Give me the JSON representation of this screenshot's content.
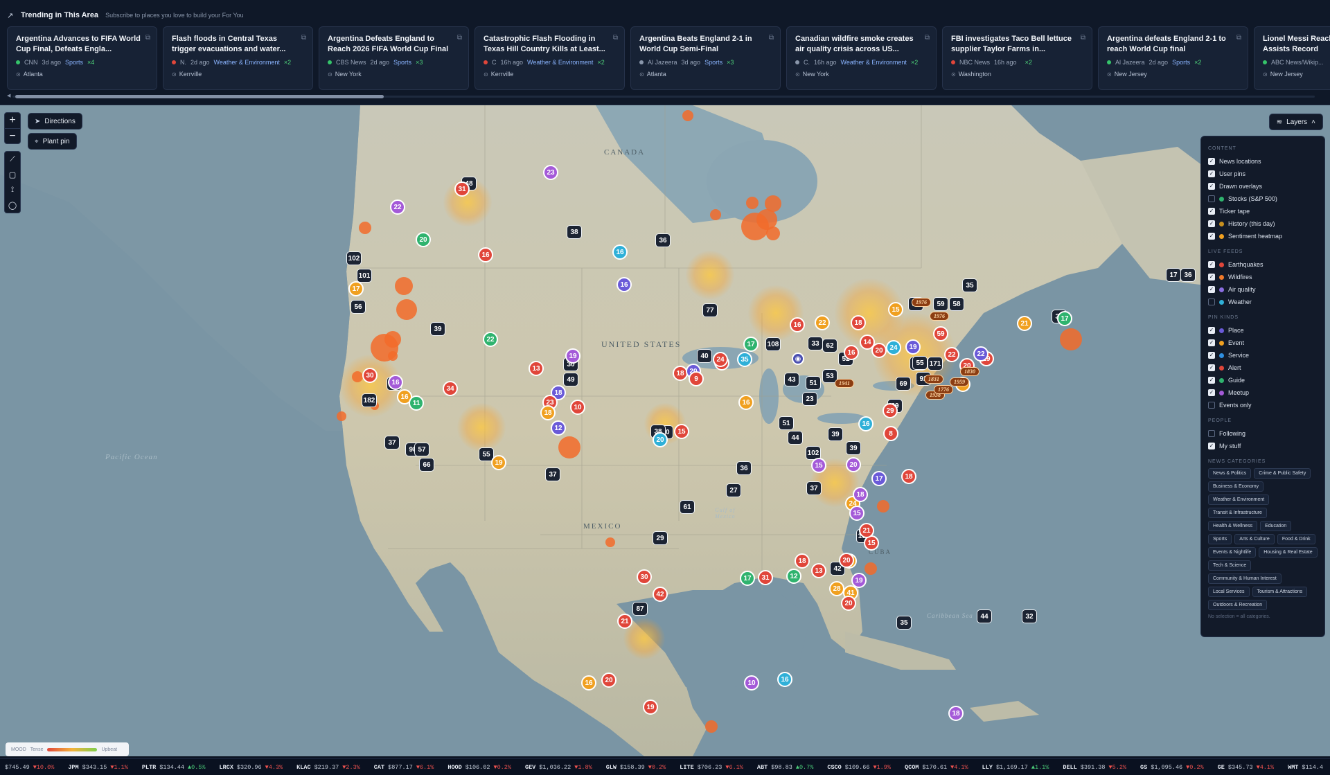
{
  "trending": {
    "title": "Trending in This Area",
    "subtitle": "Subscribe to places you love to build your For You",
    "cards": [
      {
        "title": "Argentina Advances to FIFA World Cup Final, Defeats Engla...",
        "source": "CNN",
        "age": "3d ago",
        "category": "Sports",
        "count": "×4",
        "location": "Atlanta",
        "dot_color": "#35c46a"
      },
      {
        "title": "Flash floods in Central Texas trigger evacuations and water...",
        "source": "N.",
        "age": "2d ago",
        "category": "Weather & Environment",
        "count": "×2",
        "location": "Kerrville",
        "dot_color": "#e0463a"
      },
      {
        "title": "Argentina Defeats England to Reach 2026 FIFA World Cup Final",
        "source": "CBS News",
        "age": "2d ago",
        "category": "Sports",
        "count": "×3",
        "location": "New York",
        "dot_color": "#35c46a"
      },
      {
        "title": "Catastrophic Flash Flooding in Texas Hill Country Kills at Least...",
        "source": "C",
        "age": "16h ago",
        "category": "Weather & Environment",
        "count": "×2",
        "location": "Kerrville",
        "dot_color": "#e0463a"
      },
      {
        "title": "Argentina Beats England 2-1 in World Cup Semi-Final",
        "source": "Al Jazeera",
        "age": "3d ago",
        "category": "Sports",
        "count": "×3",
        "location": "Atlanta",
        "dot_color": "#8a97ab"
      },
      {
        "title": "Canadian wildfire smoke creates air quality crisis across US...",
        "source": "C.",
        "age": "16h ago",
        "category": "Weather & Environment",
        "count": "×2",
        "location": "New York",
        "dot_color": "#8a97ab"
      },
      {
        "title": "FBI investigates Taco Bell lettuce supplier Taylor Farms in...",
        "source": "NBC News",
        "age": "16h ago",
        "category": "",
        "count": "×2",
        "location": "Washington",
        "dot_color": "#e0463a"
      },
      {
        "title": "Argentina defeats England 2-1 to reach World Cup final",
        "source": "Al Jazeera",
        "age": "2d ago",
        "category": "Sports",
        "count": "×2",
        "location": "New Jersey",
        "dot_color": "#35c46a"
      },
      {
        "title": "Lionel Messi Reaches Cup Assists Record",
        "source": "ABC News/Wikip...",
        "age": "",
        "category": "",
        "count": "",
        "location": "New Jersey",
        "dot_color": "#35c46a"
      }
    ]
  },
  "map": {
    "controls": {
      "zoom_in": "+",
      "zoom_out": "−",
      "directions": "Directions",
      "plant_pin": "Plant pin",
      "layers": "Layers"
    },
    "labels": {
      "canada": "CANADA",
      "united_states": "UNITED STATES",
      "mexico": "MEXICO",
      "cuba": "CUBA",
      "pacific": "Pacific Ocean",
      "caribbean": "Caribbean Sea",
      "gulf_mexico": "Gulf of Mexico"
    },
    "mood": {
      "label": "MOOD",
      "low": "Tense",
      "high": "Upbeat"
    }
  },
  "layers_panel": {
    "content": {
      "heading": "CONTENT",
      "items": [
        {
          "label": "News locations",
          "checked": true,
          "color": ""
        },
        {
          "label": "User pins",
          "checked": true,
          "color": ""
        },
        {
          "label": "Drawn overlays",
          "checked": true,
          "color": ""
        },
        {
          "label": "Stocks (S&P 500)",
          "checked": false,
          "color": "#2fb36e"
        },
        {
          "label": "Ticker tape",
          "checked": true,
          "color": ""
        },
        {
          "label": "History (this day)",
          "checked": true,
          "color": "#c8901e"
        },
        {
          "label": "Sentiment heatmap",
          "checked": true,
          "color": "#f0a020"
        }
      ]
    },
    "live_feeds": {
      "heading": "LIVE FEEDS",
      "items": [
        {
          "label": "Earthquakes",
          "checked": true,
          "color": "#e0463a"
        },
        {
          "label": "Wildfires",
          "checked": true,
          "color": "#f07a2a"
        },
        {
          "label": "Air quality",
          "checked": true,
          "color": "#8a6de0"
        },
        {
          "label": "Weather",
          "checked": false,
          "color": "#2fb0d8"
        }
      ]
    },
    "pin_kinds": {
      "heading": "PIN KINDS",
      "items": [
        {
          "label": "Place",
          "checked": true,
          "color": "#6a5ad8"
        },
        {
          "label": "Event",
          "checked": true,
          "color": "#f0a020"
        },
        {
          "label": "Service",
          "checked": true,
          "color": "#2f8fe0"
        },
        {
          "label": "Alert",
          "checked": true,
          "color": "#e0463a"
        },
        {
          "label": "Guide",
          "checked": true,
          "color": "#2fb36e"
        },
        {
          "label": "Meetup",
          "checked": true,
          "color": "#a45ad8"
        },
        {
          "label": "Events only",
          "checked": false,
          "color": ""
        }
      ]
    },
    "people": {
      "heading": "PEOPLE",
      "items": [
        {
          "label": "Following",
          "checked": false,
          "color": ""
        },
        {
          "label": "My stuff",
          "checked": true,
          "color": ""
        }
      ]
    },
    "news_categories": {
      "heading": "NEWS CATEGORIES",
      "chips": [
        "News & Politics",
        "Crime & Public Safety",
        "Business & Economy",
        "Weather & Environment",
        "Transit & Infrastructure",
        "Health & Wellness",
        "Education",
        "Sports",
        "Arts & Culture",
        "Food & Drink",
        "Events & Nightlife",
        "Housing & Real Estate",
        "Tech & Science",
        "Community & Human Interest",
        "Local Services",
        "Tourism & Attractions",
        "Outdoors & Recreation"
      ],
      "hint": "No selection = all categories."
    }
  },
  "markers": {
    "clusters": [
      "48",
      "38",
      "36",
      "102",
      "101",
      "56",
      "39",
      "35",
      "182",
      "37",
      "98",
      "57",
      "66",
      "55",
      "37",
      "30",
      "49",
      "37",
      "40",
      "77",
      "40",
      "108",
      "33",
      "62",
      "52",
      "43",
      "51",
      "53",
      "23",
      "58",
      "35",
      "39",
      "17",
      "30",
      "171",
      "69",
      "92",
      "39",
      "38",
      "51",
      "44",
      "102",
      "39",
      "39",
      "36",
      "27",
      "37",
      "61",
      "29",
      "104",
      "42",
      "87",
      "35",
      "44",
      "32",
      "36",
      "30",
      "55",
      "59",
      "58"
    ],
    "circles": [
      {
        "v": "23",
        "c": "#a45ad8"
      },
      {
        "v": "31",
        "c": "#e0463a"
      },
      {
        "v": "22",
        "c": "#a45ad8"
      },
      {
        "v": "20",
        "c": "#2fb36e"
      },
      {
        "v": "17",
        "c": "#f0a020"
      },
      {
        "v": "16",
        "c": "#e0463a"
      },
      {
        "v": "16",
        "c": "#2fb0d8"
      },
      {
        "v": "16",
        "c": "#6a5ad8"
      },
      {
        "v": "22",
        "c": "#2fb36e"
      },
      {
        "v": "19",
        "c": "#a45ad8"
      },
      {
        "v": "13",
        "c": "#e0463a"
      },
      {
        "v": "30",
        "c": "#e0463a"
      },
      {
        "v": "16",
        "c": "#a45ad8"
      },
      {
        "v": "16",
        "c": "#f0a020"
      },
      {
        "v": "11",
        "c": "#2fb36e"
      },
      {
        "v": "34",
        "c": "#e0463a"
      },
      {
        "v": "18",
        "c": "#6a5ad8"
      },
      {
        "v": "23",
        "c": "#e0463a"
      },
      {
        "v": "18",
        "c": "#f0a020"
      },
      {
        "v": "10",
        "c": "#e0463a"
      },
      {
        "v": "12",
        "c": "#6a5ad8"
      },
      {
        "v": "19",
        "c": "#f0a020"
      },
      {
        "v": "17",
        "c": "#2fb36e"
      },
      {
        "v": "18",
        "c": "#e0463a"
      },
      {
        "v": "20",
        "c": "#6a5ad8"
      },
      {
        "v": "30",
        "c": "#e0463a"
      },
      {
        "v": "24",
        "c": "#e0463a"
      },
      {
        "v": "35",
        "c": "#2fb0d8"
      },
      {
        "v": "20",
        "c": "#2fb0d8"
      },
      {
        "v": "9",
        "c": "#e0463a"
      },
      {
        "v": "15",
        "c": "#e0463a"
      },
      {
        "v": "16",
        "c": "#f0a020"
      },
      {
        "v": "22",
        "c": "#f0a020"
      },
      {
        "v": "16",
        "c": "#e0463a"
      },
      {
        "v": "18",
        "c": "#e0463a"
      },
      {
        "v": "16",
        "c": "#e0463a"
      },
      {
        "v": "14",
        "c": "#e0463a"
      },
      {
        "v": "20",
        "c": "#e0463a"
      },
      {
        "v": "24",
        "c": "#2fb0d8"
      },
      {
        "v": "19",
        "c": "#6a5ad8"
      },
      {
        "v": "15",
        "c": "#f0a020"
      },
      {
        "v": "59",
        "c": "#e0463a"
      },
      {
        "v": "22",
        "c": "#e0463a"
      },
      {
        "v": "20",
        "c": "#e0463a"
      },
      {
        "v": "19",
        "c": "#e0463a"
      },
      {
        "v": "22",
        "c": "#6a5ad8"
      },
      {
        "v": "14",
        "c": "#f0a020"
      },
      {
        "v": "21",
        "c": "#f0a020"
      },
      {
        "v": "17",
        "c": "#2fb36e"
      },
      {
        "v": "16",
        "c": "#2fb0d8"
      },
      {
        "v": "29",
        "c": "#e0463a"
      },
      {
        "v": "8",
        "c": "#e0463a"
      },
      {
        "v": "18",
        "c": "#e0463a"
      },
      {
        "v": "15",
        "c": "#a45ad8"
      },
      {
        "v": "20",
        "c": "#a45ad8"
      },
      {
        "v": "17",
        "c": "#6a5ad8"
      },
      {
        "v": "24",
        "c": "#f0a020"
      },
      {
        "v": "15",
        "c": "#a45ad8"
      },
      {
        "v": "18",
        "c": "#a45ad8"
      },
      {
        "v": "15",
        "c": "#e0463a"
      },
      {
        "v": "21",
        "c": "#e0463a"
      },
      {
        "v": "15",
        "c": "#f0a020"
      },
      {
        "v": "20",
        "c": "#e0463a"
      },
      {
        "v": "19",
        "c": "#a45ad8"
      },
      {
        "v": "28",
        "c": "#f0a020"
      },
      {
        "v": "13",
        "c": "#e0463a"
      },
      {
        "v": "41",
        "c": "#f0a020"
      },
      {
        "v": "12",
        "c": "#2fb36e"
      },
      {
        "v": "18",
        "c": "#e0463a"
      },
      {
        "v": "17",
        "c": "#2fb36e"
      },
      {
        "v": "31",
        "c": "#e0463a"
      },
      {
        "v": "20",
        "c": "#e0463a"
      },
      {
        "v": "30",
        "c": "#e0463a"
      },
      {
        "v": "42",
        "c": "#e0463a"
      },
      {
        "v": "21",
        "c": "#e0463a"
      },
      {
        "v": "16",
        "c": "#f0a020"
      },
      {
        "v": "20",
        "c": "#e0463a"
      },
      {
        "v": "19",
        "c": "#e0463a"
      },
      {
        "v": "10",
        "c": "#a45ad8"
      },
      {
        "v": "16",
        "c": "#2fb0d8"
      },
      {
        "v": "18",
        "c": "#a45ad8"
      }
    ],
    "history": [
      "1976",
      "1976",
      "1830",
      "1941",
      "1959",
      "1938",
      "1776",
      "1831"
    ]
  },
  "ticker": [
    {
      "sym": "",
      "price": "$745.49",
      "chg": "▼10.0%",
      "dir": "dn"
    },
    {
      "sym": "JPM",
      "price": "$343.15",
      "chg": "▼1.1%",
      "dir": "dn"
    },
    {
      "sym": "PLTR",
      "price": "$134.44",
      "chg": "▲0.5%",
      "dir": "up"
    },
    {
      "sym": "LRCX",
      "price": "$320.96",
      "chg": "▼4.3%",
      "dir": "dn"
    },
    {
      "sym": "KLAC",
      "price": "$219.37",
      "chg": "▼2.3%",
      "dir": "dn"
    },
    {
      "sym": "CAT",
      "price": "$877.17",
      "chg": "▼6.1%",
      "dir": "dn"
    },
    {
      "sym": "HOOD",
      "price": "$106.02",
      "chg": "▼0.2%",
      "dir": "dn"
    },
    {
      "sym": "GEV",
      "price": "$1,036.22",
      "chg": "▼1.8%",
      "dir": "dn"
    },
    {
      "sym": "GLW",
      "price": "$158.39",
      "chg": "▼0.2%",
      "dir": "dn"
    },
    {
      "sym": "LITE",
      "price": "$706.23",
      "chg": "▼6.1%",
      "dir": "dn"
    },
    {
      "sym": "ABT",
      "price": "$98.83",
      "chg": "▲0.7%",
      "dir": "up"
    },
    {
      "sym": "CSCO",
      "price": "$109.66",
      "chg": "▼1.9%",
      "dir": "dn"
    },
    {
      "sym": "QCOM",
      "price": "$170.61",
      "chg": "▼4.1%",
      "dir": "dn"
    },
    {
      "sym": "LLY",
      "price": "$1,169.17",
      "chg": "▲1.1%",
      "dir": "up"
    },
    {
      "sym": "DELL",
      "price": "$391.38",
      "chg": "▼5.2%",
      "dir": "dn"
    },
    {
      "sym": "GS",
      "price": "$1,095.46",
      "chg": "▼0.2%",
      "dir": "dn"
    },
    {
      "sym": "GE",
      "price": "$345.73",
      "chg": "▼4.1%",
      "dir": "dn"
    },
    {
      "sym": "WMT",
      "price": "$114.4",
      "chg": "",
      "dir": "dn"
    }
  ]
}
